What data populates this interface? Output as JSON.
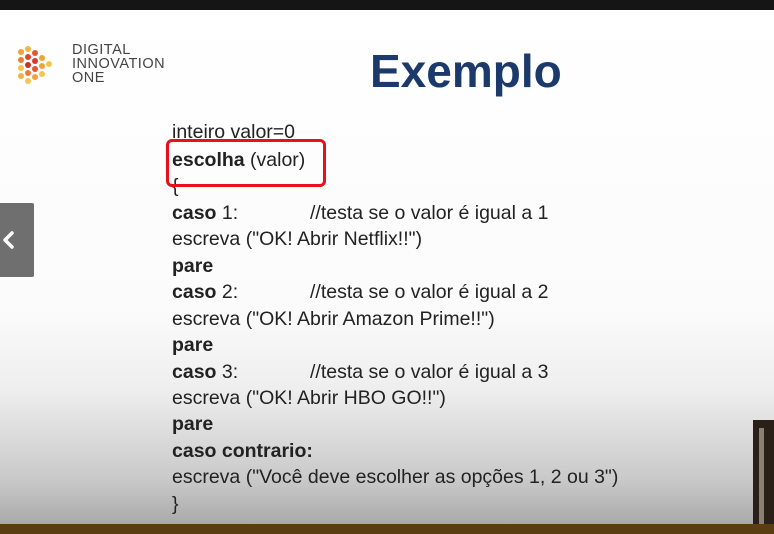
{
  "brand": {
    "line1": "DIGITAL",
    "line2": "INNOVATION",
    "line3": "ONE"
  },
  "slide": {
    "title": "Exemplo"
  },
  "code": {
    "l1": "inteiro valor=0",
    "l2_kw": "escolha",
    "l2_rest": " (valor)",
    "l3": "{",
    "l4_kw": "caso",
    "l4_rest": " 1:",
    "l4_comment": "//testa se o valor é igual a 1",
    "l5": "escreva (\"OK! Abrir Netflix!!\")",
    "l6": "pare",
    "l7_kw": "caso",
    "l7_rest": " 2:",
    "l7_comment": "//testa se o valor é igual a 2",
    "l8": "escreva (\"OK! Abrir Amazon Prime!!\")",
    "l9": "pare",
    "l10_kw": "caso",
    "l10_rest": " 3:",
    "l10_comment": "//testa se o valor é igual a 3",
    "l11": "escreva (\"OK! Abrir HBO GO!!\")",
    "l12": "pare",
    "l13": "caso contrario:",
    "l14": "escreva (\"Você deve escolher as opções 1, 2 ou 3\")",
    "l15": "}"
  },
  "colors": {
    "title": "#1b3a6b",
    "highlight": "#e8101b"
  },
  "icons": {
    "prev": "chevron-left-icon",
    "logo": "dio-logo-icon"
  }
}
